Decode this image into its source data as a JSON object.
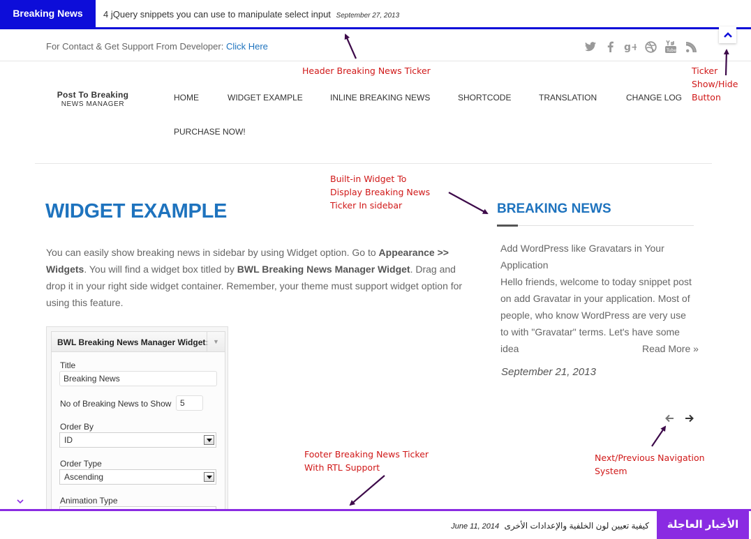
{
  "header_ticker": {
    "label": "Breaking News",
    "item": "4 jQuery snippets you can use to manipulate select input",
    "date": "September 27, 2013"
  },
  "topbar": {
    "contact_text": "For Contact & Get Support From Developer:",
    "contact_link": "Click Here",
    "social_icons": [
      "twitter-icon",
      "facebook-icon",
      "google-plus-icon",
      "dribbble-icon",
      "youtube-icon",
      "rss-icon"
    ]
  },
  "logo": {
    "line1": "Post To Breaking",
    "line2": "NEWS MANAGER"
  },
  "nav": {
    "items": [
      "HOME",
      "WIDGET EXAMPLE",
      "INLINE BREAKING NEWS",
      "SHORTCODE",
      "TRANSLATION",
      "CHANGE LOG",
      "PURCHASE NOW!"
    ]
  },
  "main": {
    "title": "WIDGET EXAMPLE",
    "intro_1": "You can easily show breaking news in sidebar by using Widget option. Go to ",
    "intro_b1": "Appearance >> Widgets",
    "intro_2": ". You will find a widget box titled by ",
    "intro_b2": "BWL Breaking News Manager Widget",
    "intro_3": ". Drag and drop it in your right side widget container. Remember, your theme must support widget option for using this feature."
  },
  "widget_panel": {
    "title": "BWL Breaking News Manager Widget:",
    "title_label": "Title",
    "title_value": "Breaking News",
    "count_label": "No of Breaking News to Show",
    "count_value": "5",
    "order_by_label": "Order By",
    "order_by_value": "ID",
    "order_type_label": "Order Type",
    "order_type_value": "Ascending",
    "animation_label": "Animation Type"
  },
  "sidebar": {
    "title": "BREAKING NEWS",
    "news_title": "Add WordPress like Gravatars in Your Application",
    "news_excerpt": "Hello friends, welcome to today snippet post on add Gravatar in your application. Most of people, who know WordPress are very use to with \"Gravatar\" terms. Let's have some idea",
    "read_more": "Read More »",
    "date": "September 21, 2013"
  },
  "annotations": {
    "header_ticker": "Header Breaking News Ticker",
    "toggle": "Ticker\nShow/Hide\nButton",
    "widget": "Built-in Widget To\nDisplay Breaking News\nTicker In sidebar",
    "footer": "Footer Breaking News Ticker\nWith RTL Support",
    "navigation": "Next/Previous Navigation\nSystem"
  },
  "footer_ticker": {
    "label": "الأخبار العاجلة",
    "item": "كيفية تعيين لون الخلفية والإعدادات الأخرى",
    "date": "June 11, 2014"
  },
  "colors": {
    "header_accent": "#0d0dd9",
    "footer_accent": "#8a2be2",
    "link_blue": "#1e73be",
    "annotation_red": "#d01818",
    "arrow_purple": "#3d0a4a"
  }
}
